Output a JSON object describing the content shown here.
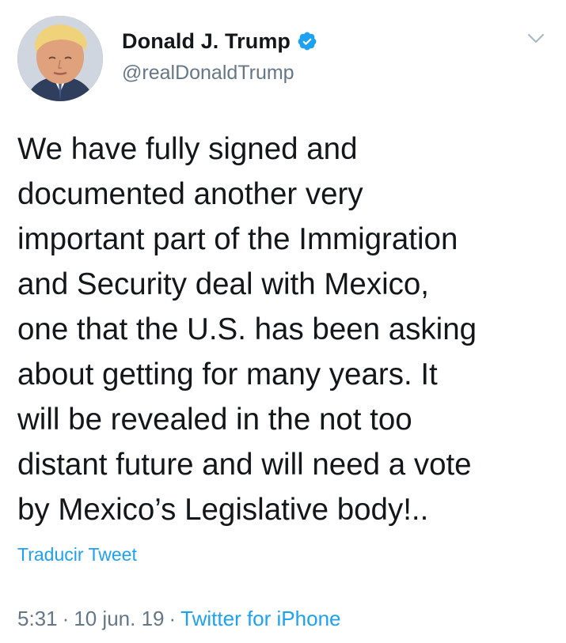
{
  "tweet": {
    "author": {
      "display_name": "Donald J. Trump",
      "handle": "@realDonaldTrump",
      "verified": true,
      "avatar_icon": "profile-photo"
    },
    "text": "We have fully signed and\ndocumented another very\nimportant part of the Immigration\nand Security deal with Mexico,\none that the U.S. has been asking\nabout getting for many years. It\nwill be revealed in the not too\ndistant future and will need a vote\nby Mexico’s Legislative body!..",
    "translate_label": "Traducir Tweet",
    "time": "5:31",
    "separator": "·",
    "date": "10 jun. 19",
    "source": "Twitter for iPhone"
  },
  "colors": {
    "text": "#14171a",
    "secondary": "#657786",
    "accent": "#1da1f2",
    "verified_badge": "#1da1f2",
    "caret": "#aab8c2"
  },
  "icons": {
    "verified": "verified-badge-icon",
    "menu": "chevron-down-icon"
  }
}
